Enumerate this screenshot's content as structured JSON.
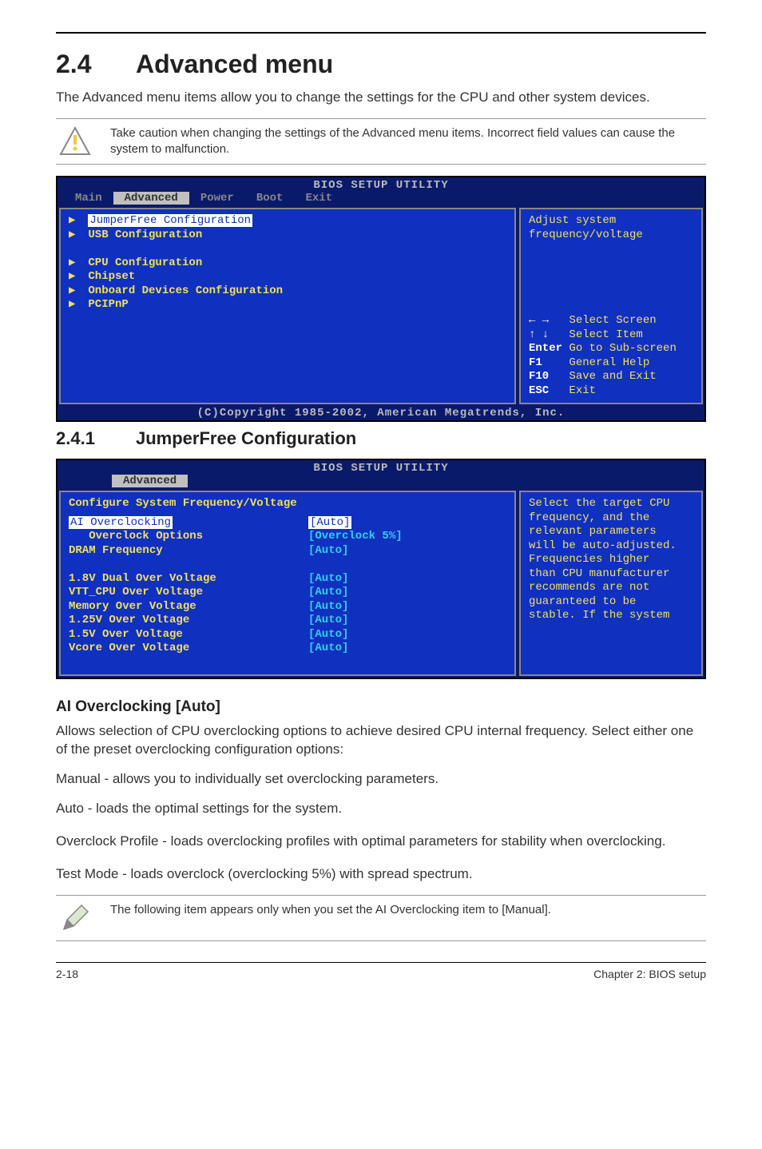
{
  "header": {
    "section_num": "2.4",
    "section_title": "Advanced menu"
  },
  "intro": "The Advanced menu items allow you to change the settings for the CPU and other system devices.",
  "callout1": "Take caution when changing the settings of the Advanced menu items. Incorrect field values can cause the system to malfunction.",
  "bios1": {
    "title": "BIOS SETUP UTILITY",
    "tabs": [
      "Main",
      "Advanced",
      "Power",
      "Boot",
      "Exit"
    ],
    "active_tab": "Advanced",
    "left_items": [
      {
        "arrow": true,
        "label": "JumperFree Configuration",
        "hl": true
      },
      {
        "arrow": true,
        "label": "USB Configuration"
      },
      {
        "spacer": true
      },
      {
        "arrow": true,
        "label": "CPU Configuration"
      },
      {
        "arrow": true,
        "label": "Chipset"
      },
      {
        "arrow": true,
        "label": "Onboard Devices Configuration"
      },
      {
        "arrow": true,
        "label": "PCIPnP"
      }
    ],
    "right_help_top": "Adjust system\nfrequency/voltage",
    "right_keys": [
      {
        "k": "← →",
        "d": "Select Screen"
      },
      {
        "k": "↑ ↓",
        "d": "Select Item"
      },
      {
        "k": "Enter",
        "d": "Go to Sub-screen"
      },
      {
        "k": "F1",
        "d": "General Help"
      },
      {
        "k": "F10",
        "d": "Save and Exit"
      },
      {
        "k": "ESC",
        "d": "Exit"
      }
    ],
    "copyright": "(C)Copyright 1985-2002, American Megatrends, Inc."
  },
  "sec241": {
    "num": "2.4.1",
    "title": "JumperFree Configuration"
  },
  "bios2": {
    "title": "BIOS SETUP UTILITY",
    "tab": "Advanced",
    "heading": "Configure System Frequency/Voltage",
    "rows": [
      {
        "label": "AI Overclocking",
        "value": "[Auto]",
        "hl": true
      },
      {
        "label": "   Overclock Options",
        "value": "[Overclock 5%]"
      },
      {
        "label": "DRAM Frequency",
        "value": "[Auto]"
      },
      {
        "spacer": true
      },
      {
        "label": "1.8V Dual Over Voltage",
        "value": "[Auto]"
      },
      {
        "label": "VTT_CPU Over Voltage",
        "value": "[Auto]"
      },
      {
        "label": "Memory Over Voltage",
        "value": "[Auto]"
      },
      {
        "label": "1.25V Over Voltage",
        "value": "[Auto]"
      },
      {
        "label": "1.5V Over Voltage",
        "value": "[Auto]"
      },
      {
        "label": "Vcore Over Voltage",
        "value": "[Auto]"
      }
    ],
    "right_help": "Select the target CPU\nfrequency, and the\nrelevant parameters\nwill be auto-adjusted.\nFrequencies higher\nthan CPU manufacturer\nrecommends are not\nguaranteed to be\nstable. If the system"
  },
  "sub_ai_title": "AI Overclocking [Auto]",
  "sub_ai_body": "Allows selection of CPU overclocking options to achieve desired CPU internal frequency. Select either one of the preset overclocking configuration options:",
  "line_manual": "Manual - allows you to individually set overclocking parameters.",
  "line_auto": "Auto - loads the optimal settings for the system.",
  "line_profile": "Overclock Profile - loads overclocking profiles with optimal parameters for stability when overclocking.",
  "line_test": "Test Mode - loads overclock (overclocking 5%) with spread spectrum.",
  "callout2": "The following item appears only when you set the AI Overclocking item to [Manual].",
  "footer": {
    "left": "2-18",
    "right": "Chapter 2: BIOS setup"
  }
}
